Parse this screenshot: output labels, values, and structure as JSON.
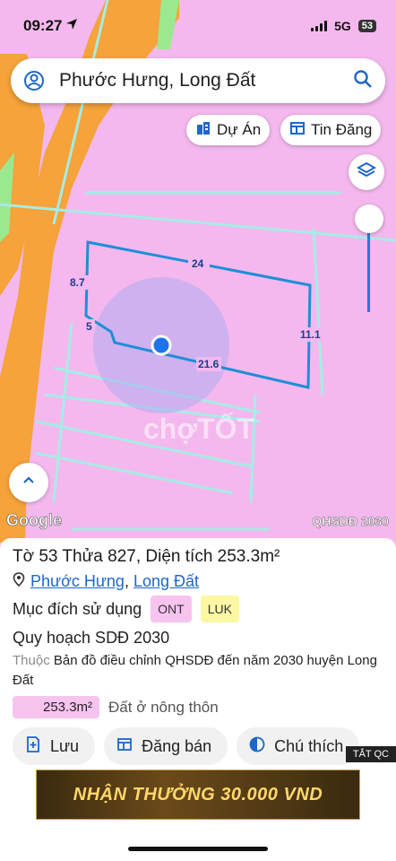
{
  "status": {
    "time": "09:27",
    "network": "5G",
    "battery": "53"
  },
  "search": {
    "query": "Phước Hưng, Long Đất"
  },
  "chips": {
    "projects": "Dự Án",
    "listings": "Tin Đăng"
  },
  "map": {
    "edge_labels": [
      "24",
      "8.7",
      "5",
      "11.1",
      "21.6"
    ],
    "watermark": "chợTỐT",
    "google": "Google",
    "code": "QHSDĐ 2030"
  },
  "parcel": {
    "title": "Tờ 53 Thửa 827, Diện tích 253.3m²",
    "ward": "Phước Hưng",
    "separator": ",",
    "district": "Long Đất",
    "purpose_label": "Mục đích sử dụng",
    "badge1": "ONT",
    "badge2": "LUK",
    "plan_title": "Quy hoạch SDĐ 2030",
    "plan_prefix": "Thuộc",
    "plan_desc": "Bản đồ điều chỉnh QHSDĐ đến năm 2030 huyện Long Đất",
    "area_value": "253.3m²",
    "area_label": "Đất ở nông thôn"
  },
  "actions": {
    "save": "Lưu",
    "sell": "Đăng bán",
    "legend": "Chú thích"
  },
  "ad": {
    "label": "TẮT QC",
    "text": "NHẬN THƯỞNG 30.000 VND"
  },
  "colors": {
    "map_pink": "#f4b8ee",
    "road_orange": "#f5a33a",
    "parcel_blue": "#1e8ed8",
    "link_blue": "#1e66c8"
  }
}
